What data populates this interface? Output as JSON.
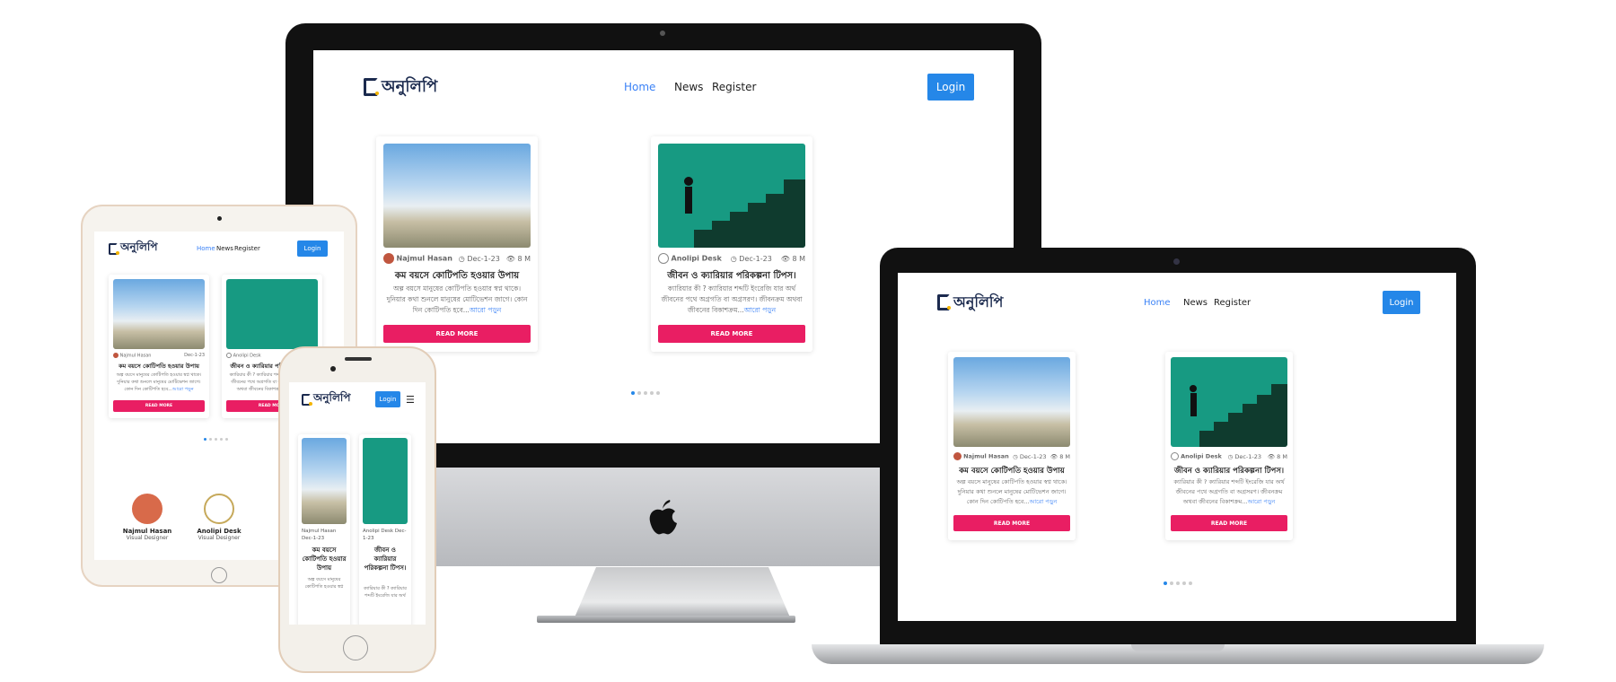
{
  "site": {
    "logo_text": "অনুলিপি",
    "nav": {
      "home": "Home",
      "news": "News",
      "register": "Register"
    },
    "login": "Login",
    "read_more": "READ MORE",
    "more_link": "আরো পড়ুন",
    "colors": {
      "accent_blue": "#2587e8",
      "read_btn": "#e91e63",
      "card_teal": "#179a82"
    }
  },
  "posts": [
    {
      "author": "Najmul Hasan",
      "date": "Dec-1-23",
      "views": "8 M",
      "title": "কম বয়সে কোটিপতি হওয়ার উপায়",
      "excerpt": "অল্প বয়সে মানুষের কোটিপতি হওয়ার স্বপ্ন থাকে। দুনিয়ার কথা শুনলে মানুষের মোটিভেশন জাগে। কোন দিন কোটিপতি হবে...",
      "image": "clouds-money-man"
    },
    {
      "author": "Anolipi Desk",
      "date": "Dec-1-23",
      "views": "8 M",
      "title": "জীবন ও ক্যারিয়ার পরিকল্পনা টিপস।",
      "excerpt": "ক্যারিয়ার কী ? ক্যারিয়ার শব্দটি ইংরেজি যার অর্থ জীবনের পথে অগ্রগতি বা অগ্রসরণ। জীবনক্রম অথবা জীবনের বিকাশক্রম...",
      "image": "stairs-businessman"
    }
  ],
  "team": [
    {
      "name": "Najmul Hasan",
      "role": "Visual Designer"
    },
    {
      "name": "Anolipi Desk",
      "role": "Visual Designer"
    }
  ],
  "phone": {
    "post1_author": "Najmul Hasan",
    "post1_date": "Dec-1-23",
    "post1_title": "কম বয়সে কোটিপতি হওয়ার উপায়",
    "post1_text": "অল্প বয়সে মানুষের কোটিপতি হওয়ার স্বপ্ন",
    "post2_author": "Anolipi Desk",
    "post2_date": "Dec-1-23",
    "post2_title": "জীবন ও ক্যারিয়ার পরিকল্পনা টিপস।",
    "post2_text": "ক্যারিয়ার কী ? ক্যারিয়ার শব্দটি ইংরেজি যার অর্থ"
  },
  "icons": [
    "apple-logo-icon",
    "menu-icon",
    "clock-icon",
    "eye-icon"
  ]
}
